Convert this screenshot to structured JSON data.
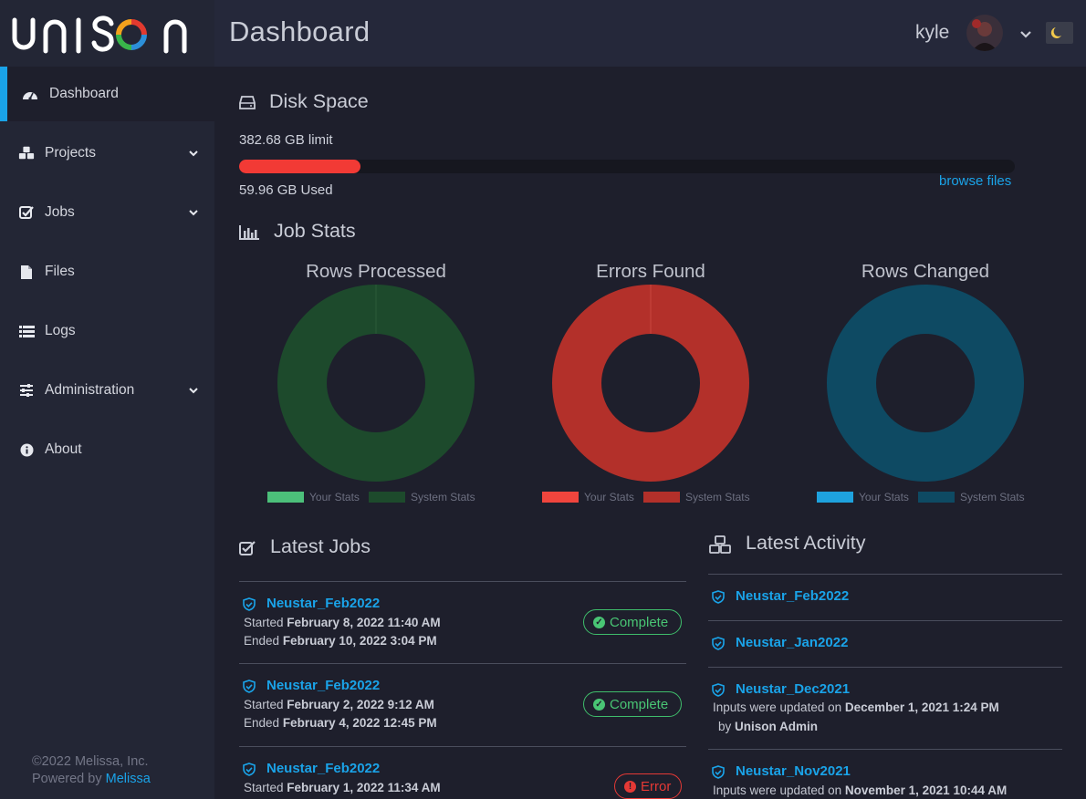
{
  "brand": {
    "logo_text": "UNISON"
  },
  "header": {
    "title": "Dashboard",
    "username": "kyle"
  },
  "sidebar": {
    "items": [
      {
        "label": "Dashboard",
        "icon": "tachometer-icon",
        "active": true
      },
      {
        "label": "Projects",
        "icon": "cubes-icon",
        "has_submenu": true
      },
      {
        "label": "Jobs",
        "icon": "check-square-icon",
        "has_submenu": true
      },
      {
        "label": "Files",
        "icon": "file-icon"
      },
      {
        "label": "Logs",
        "icon": "list-icon"
      },
      {
        "label": "Administration",
        "icon": "sliders-icon",
        "has_submenu": true
      },
      {
        "label": "About",
        "icon": "info-circle-icon"
      }
    ],
    "footer": {
      "copyright": "©2022 Melissa, Inc.",
      "powered_by": "Powered by",
      "powered_link": "Melissa"
    }
  },
  "disk": {
    "title": "Disk Space",
    "limit_text": "382.68 GB limit",
    "used_text": "59.96 GB Used",
    "used_fraction": 0.157,
    "browse_label": "browse files"
  },
  "job_stats": {
    "title": "Job Stats",
    "legend_your": "Your Stats",
    "legend_system": "System Stats",
    "charts": [
      {
        "title": "Rows Processed",
        "your_color": "#4cbf7a",
        "system_color": "#1d4a2c"
      },
      {
        "title": "Errors Found",
        "your_color": "#f0453d",
        "system_color": "#b3302a"
      },
      {
        "title": "Rows Changed",
        "your_color": "#1ea2de",
        "system_color": "#0e4a63"
      }
    ]
  },
  "latest_jobs": {
    "title": "Latest Jobs",
    "items": [
      {
        "name": "Neustar_Feb2022",
        "started_label": "Started",
        "started": "February 8, 2022 11:40 AM",
        "ended_label": "Ended",
        "ended": "February 10, 2022 3:04 PM",
        "status": "Complete"
      },
      {
        "name": "Neustar_Feb2022",
        "started_label": "Started",
        "started": "February 2, 2022 9:12 AM",
        "ended_label": "Ended",
        "ended": "February 4, 2022 12:45 PM",
        "status": "Complete"
      },
      {
        "name": "Neustar_Feb2022",
        "started_label": "Started",
        "started": "February 1, 2022 11:34 AM",
        "status": "Error"
      }
    ]
  },
  "latest_activity": {
    "title": "Latest Activity",
    "items": [
      {
        "name": "Neustar_Feb2022"
      },
      {
        "name": "Neustar_Jan2022"
      },
      {
        "name": "Neustar_Dec2021",
        "detail_label": "Inputs were updated on",
        "detail_date": "December 1, 2021 1:24 PM",
        "by_label": "by",
        "by_user": "Unison Admin"
      },
      {
        "name": "Neustar_Nov2021",
        "detail_label": "Inputs were updated on",
        "detail_date": "November 1, 2021 10:44 AM"
      }
    ]
  },
  "colors": {
    "accent": "#1aa3e8",
    "sidebar_bg": "#232635",
    "content_bg": "#1e1f2c",
    "header_bg": "#25283a",
    "danger": "#f23a35",
    "success": "#49c574"
  }
}
